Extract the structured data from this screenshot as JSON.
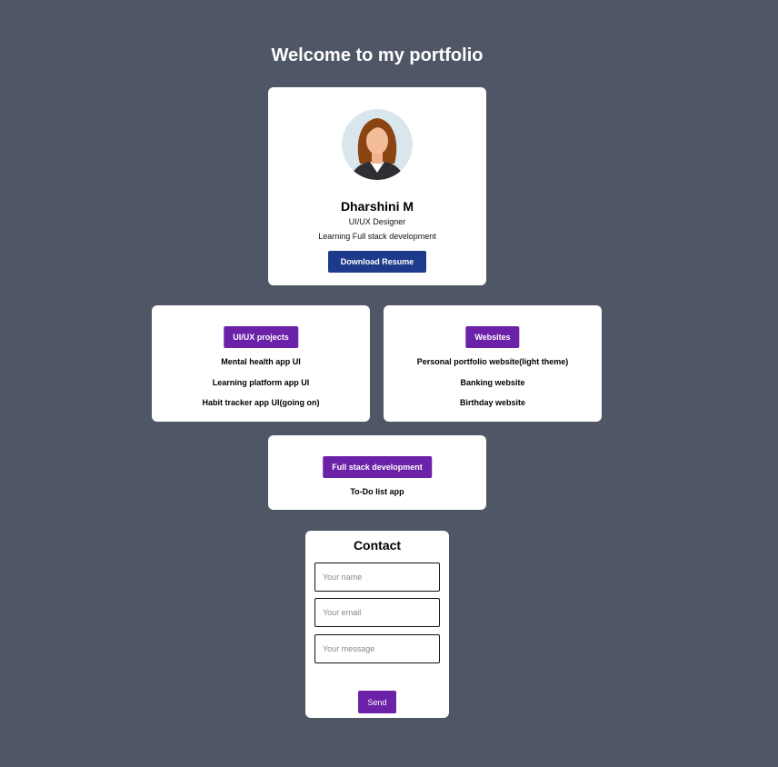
{
  "page": {
    "title": "Welcome to my portfolio",
    "background": "#4f5665"
  },
  "profile": {
    "avatar_icon": "woman-avatar-icon",
    "name": "Dharshini M",
    "role": "UI/UX Designer",
    "learning": "Learning Full stack development",
    "download_label": "Download Resume",
    "button_color": "#1e3a8a"
  },
  "uiux": {
    "tag": "UI/UX projects",
    "items": [
      "Mental health app UI",
      "Learning platform app UI",
      "Habit tracker app UI(going on)"
    ]
  },
  "websites": {
    "tag": "Websites",
    "items": [
      "Personal portfolio website(light theme)",
      "Banking website",
      "Birthday website"
    ]
  },
  "fullstack": {
    "tag": "Full stack development",
    "items": [
      "To-Do list app"
    ]
  },
  "contact": {
    "title": "Contact",
    "name_placeholder": "Your name",
    "email_placeholder": "Your email",
    "message_placeholder": "Your message",
    "send_label": "Send"
  },
  "colors": {
    "accent": "#6b21a8",
    "card": "#ffffff"
  }
}
